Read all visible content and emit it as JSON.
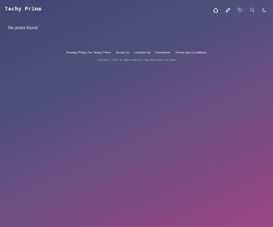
{
  "site": {
    "title": "Techy Prime"
  },
  "nav": {
    "items": [
      {
        "icon": "home-icon",
        "label": "Home"
      },
      {
        "icon": "pencil-icon",
        "label": "Write"
      },
      {
        "icon": "tag-icon",
        "label": "Tags"
      },
      {
        "icon": "search-icon",
        "label": "Search"
      },
      {
        "icon": "moon-icon",
        "label": "Dark mode"
      }
    ]
  },
  "main": {
    "empty_message": "No posts found"
  },
  "footer": {
    "links": [
      {
        "label": "Privacy Policy For Techy Prime"
      },
      {
        "label": "About Us"
      },
      {
        "label": "Contact Us"
      },
      {
        "label": "Disclaimer"
      },
      {
        "label": "Terms and Conditions"
      }
    ],
    "copyright": "Copyright © 2025. All rights reserved. Hugo Blox theme by Dyaris"
  },
  "colors": {
    "gradient_start": "#3e4871",
    "gradient_mid": "#6f4f86",
    "gradient_end": "#9a4786",
    "text": "#ffffff"
  }
}
